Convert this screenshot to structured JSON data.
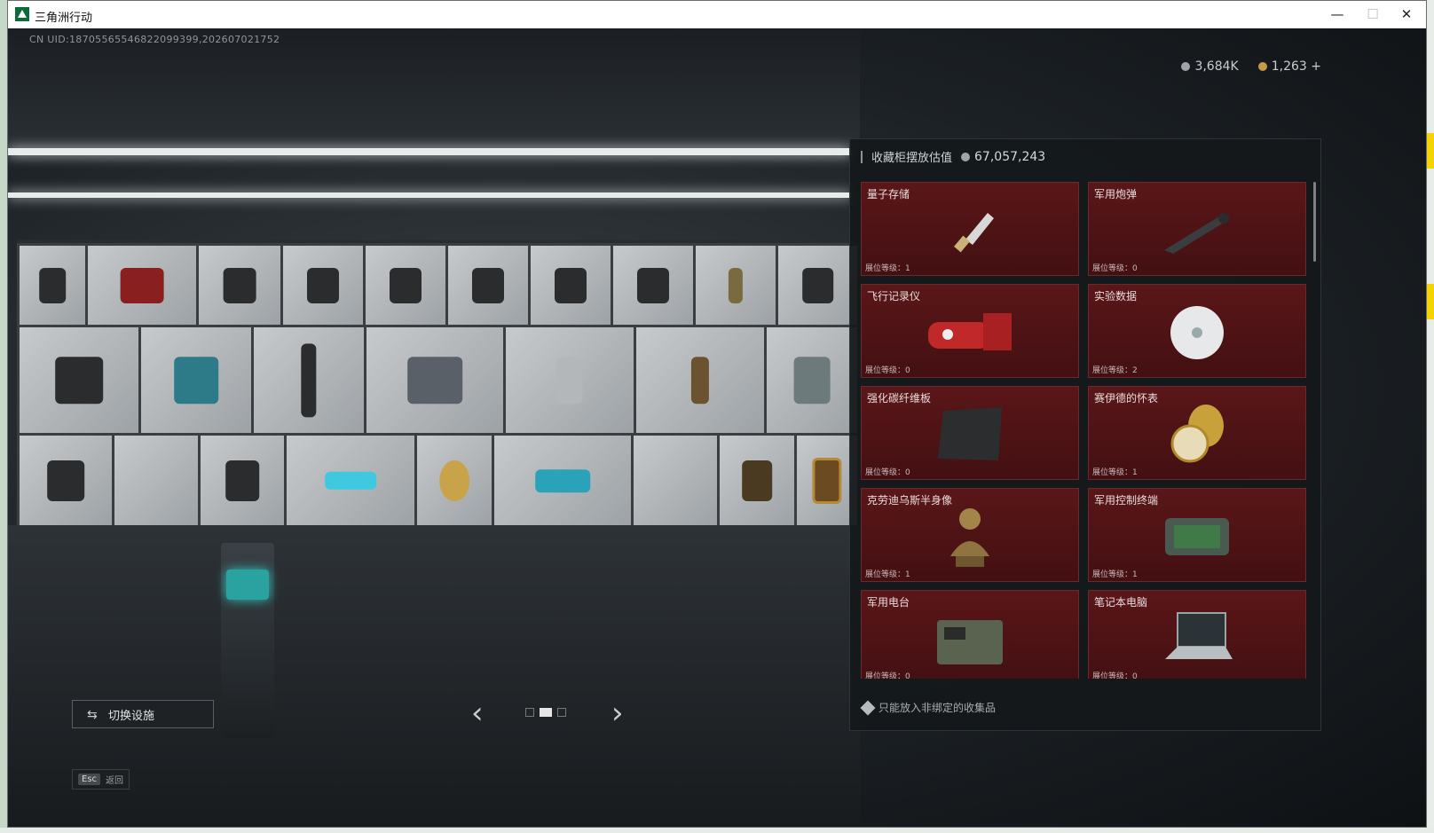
{
  "window": {
    "title": "三角洲行动",
    "controls": [
      "—",
      "☐",
      "✕"
    ]
  },
  "hud": {
    "uid": "CN UID:18705565546822099399,202607021752",
    "currency_silver": "3,684K",
    "currency_gold": "1,263",
    "plus": "+"
  },
  "panel": {
    "title": "收藏柜摆放估值",
    "value": "67,057,243",
    "items": [
      {
        "name": "量子存储",
        "level": "展位等级：1"
      },
      {
        "name": "军用炮弹",
        "level": "展位等级：0"
      },
      {
        "name": "飞行记录仪",
        "level": "展位等级：0"
      },
      {
        "name": "实验数据",
        "level": "展位等级：2"
      },
      {
        "name": "强化碳纤维板",
        "level": "展位等级：0"
      },
      {
        "name": "赛伊德的怀表",
        "level": "展位等级：1"
      },
      {
        "name": "克劳迪乌斯半身像",
        "level": "展位等级：1"
      },
      {
        "name": "军用控制终端",
        "level": "展位等级：1"
      },
      {
        "name": "军用电台",
        "level": "展位等级：0"
      },
      {
        "name": "笔记本电脑",
        "level": "展位等级：0"
      }
    ],
    "note": "只能放入非绑定的收集品"
  },
  "controls": {
    "switch_label": "切换设施",
    "esc_key": "Esc",
    "esc_label": "返回"
  },
  "colors": {
    "item_bg": "#4d1315",
    "panel_bg": "#14181b"
  }
}
